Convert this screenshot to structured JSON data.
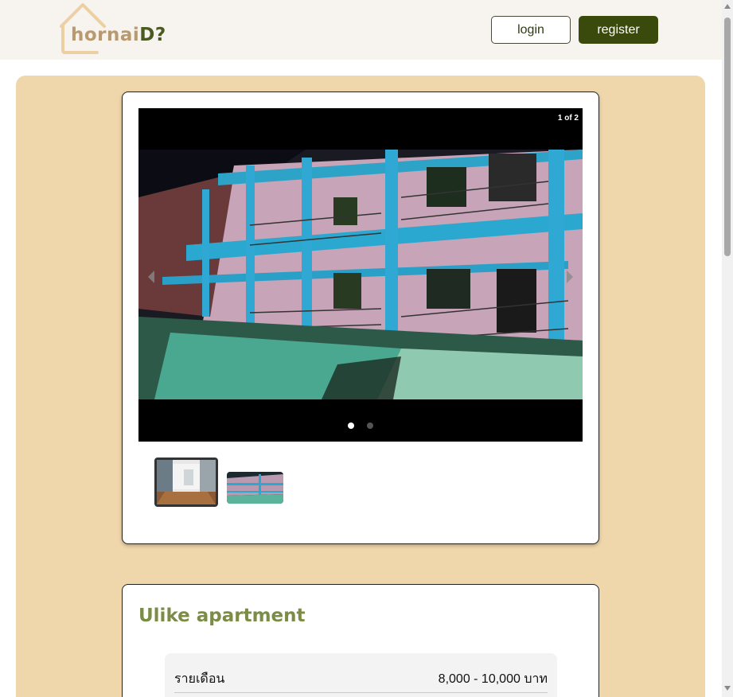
{
  "header": {
    "logo_text_part1": "hornai",
    "logo_text_part2": "D?",
    "login_label": "login",
    "register_label": "register"
  },
  "gallery": {
    "counter": "1 of 2",
    "total_images": 2,
    "active_index": 1
  },
  "listing": {
    "title": "Ulike apartment",
    "price_label": "รายเดือน",
    "price_value": "8,000 - 10,000 บาท"
  },
  "colors": {
    "header_bg": "#f7f3ee",
    "main_bg": "#efd6ab",
    "brand_dark": "#3a4a0c",
    "title_green": "#7a8c46"
  }
}
